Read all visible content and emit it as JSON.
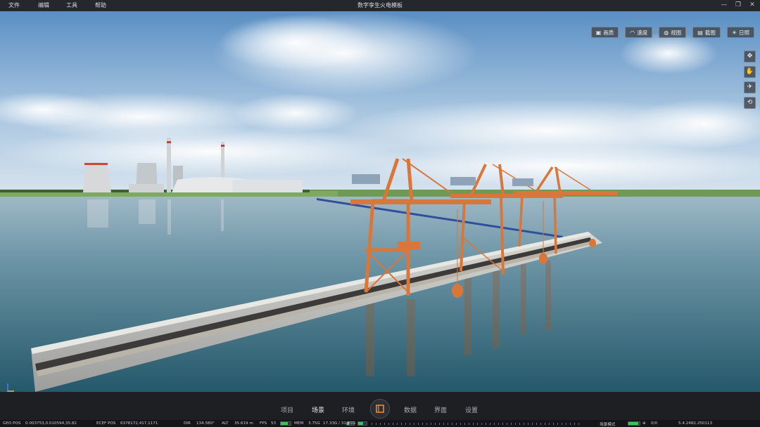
{
  "menubar": {
    "items": [
      "文件",
      "编辑",
      "工具",
      "帮助"
    ],
    "title": "数字孪生火电模板"
  },
  "toolbar": {
    "buttons": [
      {
        "label": "画质",
        "icon": "image-icon"
      },
      {
        "label": "速度",
        "icon": "gauge-icon"
      },
      {
        "label": "视图",
        "icon": "views-icon"
      },
      {
        "label": "截图",
        "icon": "screenshot-icon"
      },
      {
        "label": "日照",
        "icon": "sun-icon"
      }
    ]
  },
  "side_tools": [
    "move-icon",
    "orbit-hand-icon",
    "walk-icon",
    "view-reset-icon"
  ],
  "bottom_nav": {
    "tabs": [
      "项目",
      "场景",
      "环境",
      "数据",
      "界面",
      "设置"
    ],
    "active": "场景",
    "center_icon": "logo-cube-icon"
  },
  "status": {
    "geo_pos_label": "GEO POS",
    "geo_pos_value": "0.003753,0.010594,35.82",
    "ecef_pos_label": "ECEF POS",
    "ecef_pos_value": "6378172,417,1171",
    "dir_label": "DIR",
    "dir_value": "134.580°",
    "alt_label": "ALT",
    "alt_value": "35.619 m",
    "fps_label": "FPS",
    "fps_value": "53",
    "fps_level": 0.7,
    "mem_label": "MEM",
    "mem_value": "3.75G",
    "mem_level": 0.25,
    "gpu_value": "17.33G / 31.91G",
    "gpu_level": 0.55,
    "scene_mode_label": "场景模式",
    "scene_mode_level": 0.9,
    "count_value": "0/0",
    "version_value": "5.4.2482.250113"
  },
  "colors": {
    "crane": "#d9773a",
    "accent_green": "#3fbf5f",
    "panel_bg": "#1d1f22"
  }
}
